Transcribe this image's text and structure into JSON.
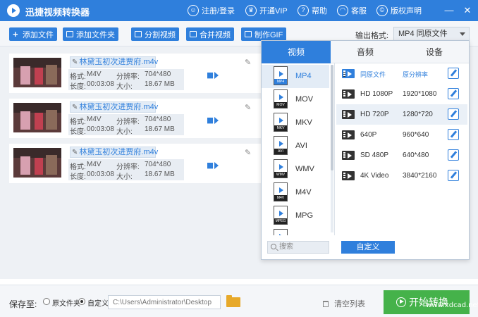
{
  "app": {
    "title": "迅捷视频转换器",
    "links": [
      {
        "label": "注册/登录",
        "icon": "user-icon"
      },
      {
        "label": "开通VIP",
        "icon": "crown-icon"
      },
      {
        "label": "帮助",
        "icon": "help-icon"
      },
      {
        "label": "客服",
        "icon": "headset-icon"
      },
      {
        "label": "版权声明",
        "icon": "copyright-icon"
      }
    ],
    "window_controls": {
      "minimize": "—",
      "close": "✕"
    }
  },
  "toolbar": {
    "buttons": [
      {
        "label": "添加文件",
        "icon": "plus-icon"
      },
      {
        "label": "添加文件夹",
        "icon": "folder-icon"
      },
      {
        "label": "分割视频",
        "icon": "split-icon"
      },
      {
        "label": "合并视频",
        "icon": "merge-icon"
      },
      {
        "label": "制作GIF",
        "icon": "gif-icon"
      }
    ],
    "output_format_label": "输出格式:",
    "output_format_value": "MP4  同原文件"
  },
  "files": [
    {
      "name": "林黛玉初次进贾府.m4v",
      "format_label": "格式:",
      "format": "M4V",
      "resolution_label": "分辨率:",
      "resolution": "704*480",
      "duration_label": "长度:",
      "duration": "00:03:08",
      "size_label": "大小:",
      "size": "18.67 MB"
    },
    {
      "name": "林黛玉初次进贾府.m4v",
      "format_label": "格式:",
      "format": "M4V",
      "resolution_label": "分辨率:",
      "resolution": "704*480",
      "duration_label": "长度:",
      "duration": "00:03:08",
      "size_label": "大小:",
      "size": "18.67 MB"
    },
    {
      "name": "林黛玉初次进贾府.m4v",
      "format_label": "格式:",
      "format": "M4V",
      "resolution_label": "分辨率:",
      "resolution": "704*480",
      "duration_label": "长度:",
      "duration": "00:03:08",
      "size_label": "大小:",
      "size": "18.67 MB"
    }
  ],
  "popup": {
    "tabs": [
      "视频",
      "音频",
      "设备"
    ],
    "active_tab": "视频",
    "formats": [
      {
        "name": "MP4",
        "badge": "MP4"
      },
      {
        "name": "MOV",
        "badge": "MOV"
      },
      {
        "name": "MKV",
        "badge": "MKV"
      },
      {
        "name": "AVI",
        "badge": "AVI"
      },
      {
        "name": "WMV",
        "badge": "WMV"
      },
      {
        "name": "M4V",
        "badge": "M4V"
      },
      {
        "name": "MPG",
        "badge": "MPEG"
      },
      {
        "name": "",
        "badge": ""
      }
    ],
    "selected_format": "MP4",
    "presets": [
      {
        "name": "同原文件",
        "resolution": "原分辨率"
      },
      {
        "name": "HD 1080P",
        "resolution": "1920*1080"
      },
      {
        "name": "HD 720P",
        "resolution": "1280*720"
      },
      {
        "name": "640P",
        "resolution": "960*640"
      },
      {
        "name": "SD 480P",
        "resolution": "640*480"
      },
      {
        "name": "4K Video",
        "resolution": "3840*2160"
      }
    ],
    "highlighted_preset": "HD 720P",
    "search_placeholder": "搜索",
    "custom_button": "自定义"
  },
  "bottom": {
    "save_label": "保存至:",
    "option_original": "原文件夹",
    "option_custom": "自定义",
    "selected_option": "自定义",
    "path": "C:\\Users\\Administrator\\Desktop",
    "clear_label": "清空列表",
    "start_label": "开始转换"
  },
  "watermark": "www.xdcad.net",
  "colors": {
    "primary": "#2f7fdc",
    "start": "#45b24a"
  }
}
